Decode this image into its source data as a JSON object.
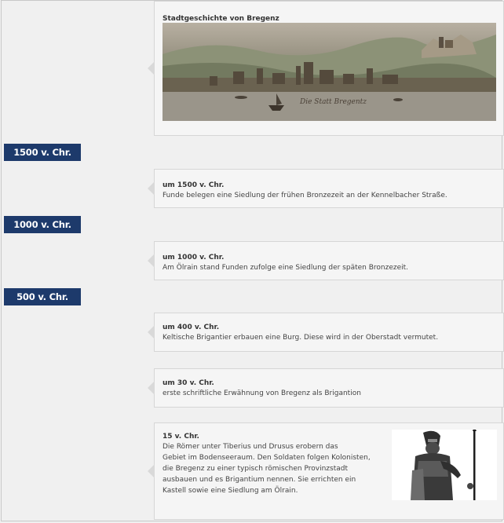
{
  "intro": {
    "title": "Stadtgeschichte von Bregenz",
    "image_caption": "Die Statt Bregentz"
  },
  "eras": [
    "1500 v. Chr.",
    "1000 v. Chr.",
    "500 v. Chr."
  ],
  "events": [
    {
      "title": "um 1500 v. Chr.",
      "text": "Funde belegen eine Siedlung der frühen Bronzezeit an der Kennelbacher Straße."
    },
    {
      "title": "um 1000 v. Chr.",
      "text": "Am Ölrain stand Funden zufolge eine Siedlung der späten Bronzezeit."
    },
    {
      "title": "um 400 v. Chr.",
      "text": "Keltische Brigantier erbauen eine Burg. Diese wird in der Oberstadt vermutet."
    },
    {
      "title": "um 30 v. Chr.",
      "text": "erste schriftliche Erwähnung von Bregenz als Brigantion"
    },
    {
      "title": "15 v. Chr.",
      "lines": [
        "Die Römer unter Tiberius und Drusus erobern das",
        "Gebiet im Bodenseeraum. Den Soldaten folgen Kolonisten,",
        "die Bregenz zu einer typisch römischen Provinzstadt",
        "ausbauen und es Brigantium nennen. Sie errichten ein",
        "Kastell sowie eine Siedlung am Ölrain."
      ]
    }
  ]
}
